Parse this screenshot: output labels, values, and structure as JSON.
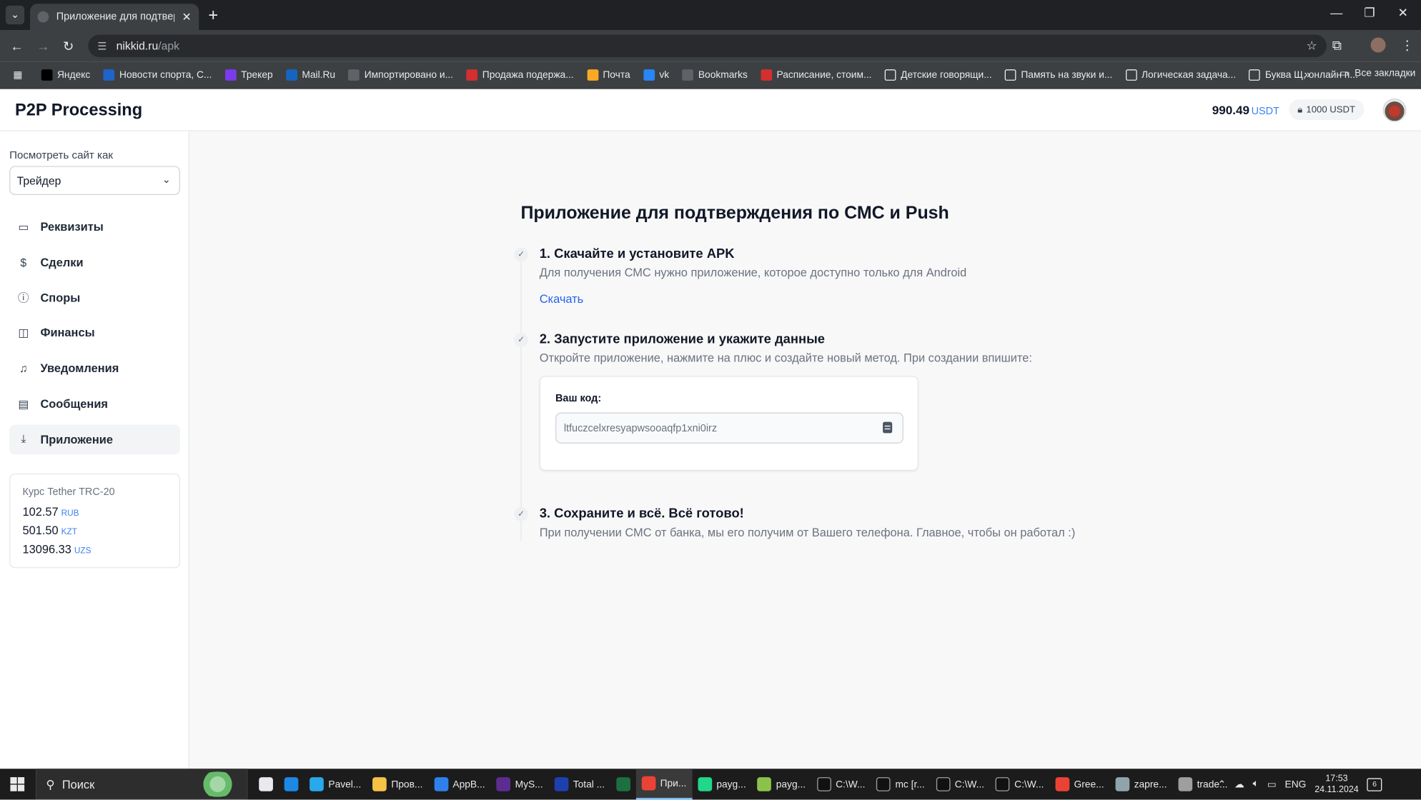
{
  "browser": {
    "tab_title": "Приложение для подтвержде",
    "url_host": "nikkid.ru",
    "url_path": "/apk",
    "bookmarks": [
      {
        "label": "Яндекс",
        "icon": "yandex-icon",
        "color": "#000000"
      },
      {
        "label": "Новости спорта, С...",
        "icon": "news-icon",
        "color": "#1e63c9"
      },
      {
        "label": "Трекер",
        "icon": "tracker-icon",
        "color": "#7c3aed"
      },
      {
        "label": "Mail.Ru",
        "icon": "at-icon",
        "color": "#1565c0"
      },
      {
        "label": "Импортировано и...",
        "icon": "folder-icon",
        "color": "#5f6368"
      },
      {
        "label": "Продажа подержа...",
        "icon": "car-icon",
        "color": "#d32f2f"
      },
      {
        "label": "Почта",
        "icon": "mail-icon",
        "color": "#f9a825"
      },
      {
        "label": "vk",
        "icon": "vk-icon",
        "color": "#2787f5"
      },
      {
        "label": "Bookmarks",
        "icon": "star-icon",
        "color": "#5f6368"
      },
      {
        "label": "Расписание, стоим...",
        "icon": "train-icon",
        "color": "#d32f2f"
      },
      {
        "label": "Детские говорящи...",
        "icon": "house-icon",
        "color": "#ffffff"
      },
      {
        "label": "Память на звуки и...",
        "icon": "house-icon",
        "color": "#ffffff"
      },
      {
        "label": "Логическая задача...",
        "icon": "house-icon",
        "color": "#ffffff"
      },
      {
        "label": "Буква Щ, онлайн п...",
        "icon": "house-icon",
        "color": "#ffffff"
      }
    ],
    "bookmarks_more": "»",
    "all_bookmarks": "Все закладки"
  },
  "header": {
    "logo": "P2P Processing",
    "balance": "990.49",
    "balance_currency": "USDT",
    "frozen": "1000 USDT"
  },
  "sidebar": {
    "view_as_label": "Посмотреть сайт как",
    "role_selected": "Трейдер",
    "items": [
      {
        "label": "Реквизиты",
        "icon": "card-icon",
        "glyph": "▭"
      },
      {
        "label": "Сделки",
        "icon": "dollar-icon",
        "glyph": "$"
      },
      {
        "label": "Споры",
        "icon": "alert-circle-icon",
        "glyph": "ⓘ"
      },
      {
        "label": "Финансы",
        "icon": "wallet-icon",
        "glyph": "◫"
      },
      {
        "label": "Уведомления",
        "icon": "bell-icon",
        "glyph": "♫"
      },
      {
        "label": "Сообщения",
        "icon": "message-icon",
        "glyph": "▤"
      },
      {
        "label": "Приложение",
        "icon": "download-icon",
        "glyph": "⤓"
      }
    ],
    "rates": {
      "title": "Курс Tether TRC-20",
      "rows": [
        {
          "value": "102.57",
          "currency": "RUB"
        },
        {
          "value": "501.50",
          "currency": "KZT"
        },
        {
          "value": "13096.33",
          "currency": "UZS"
        }
      ]
    }
  },
  "main": {
    "title": "Приложение для подтверждения по СМС и Push",
    "step1": {
      "title": "1. Скачайте и установите APK",
      "desc": "Для получения СМС нужно приложение, которое доступно только для Android",
      "link": "Скачать"
    },
    "step2": {
      "title": "2. Запустите приложение и укажите данные",
      "desc": "Откройте приложение, нажмите на плюс и создайте новый метод. При создании впишите:",
      "code_label": "Ваш код:",
      "code_value": "ltfuczcelxresyapwsooaqfp1xni0irz"
    },
    "step3": {
      "title": "3. Сохраните и всё. Всё готово!",
      "desc": "При получении СМС от банка, мы его получим от Вашего телефона. Главное, чтобы он работал :)"
    }
  },
  "taskbar": {
    "search_placeholder": "Поиск",
    "apps": [
      {
        "label": "",
        "icon": "task-view-icon",
        "color": "#e8eaed"
      },
      {
        "label": "",
        "icon": "edge-icon",
        "color": "#1e88e5"
      },
      {
        "label": "Pavel...",
        "icon": "telegram-icon",
        "color": "#29a9eb"
      },
      {
        "label": "Пров...",
        "icon": "explorer-icon",
        "color": "#f6c344"
      },
      {
        "label": "AppB...",
        "icon": "vscode-icon",
        "color": "#2f80ed"
      },
      {
        "label": "MyS...",
        "icon": "vs-icon",
        "color": "#5c2d91"
      },
      {
        "label": "Total ...",
        "icon": "totalcmd-icon",
        "color": "#1e40af"
      },
      {
        "label": "",
        "icon": "excel-icon",
        "color": "#1d6f42"
      },
      {
        "label": "При...",
        "icon": "chrome-icon",
        "color": "#ea4335"
      },
      {
        "label": "payg...",
        "icon": "pycharm-icon",
        "color": "#21d789"
      },
      {
        "label": "payg...",
        "icon": "app-icon",
        "color": "#8bc34a"
      },
      {
        "label": "C:\\W...",
        "icon": "terminal-icon",
        "color": "#111111"
      },
      {
        "label": "mc [r...",
        "icon": "terminal-icon",
        "color": "#111111"
      },
      {
        "label": "C:\\W...",
        "icon": "terminal-icon",
        "color": "#111111"
      },
      {
        "label": "C:\\W...",
        "icon": "terminal-icon",
        "color": "#111111"
      },
      {
        "label": "Gree...",
        "icon": "chrome-icon",
        "color": "#ea4335"
      },
      {
        "label": "zapre...",
        "icon": "window-icon",
        "color": "#90a4ae"
      },
      {
        "label": "trade...",
        "icon": "tool-icon",
        "color": "#9e9e9e"
      }
    ],
    "lang": "ENG",
    "time": "17:53",
    "date": "24.11.2024",
    "notifications": "6"
  }
}
